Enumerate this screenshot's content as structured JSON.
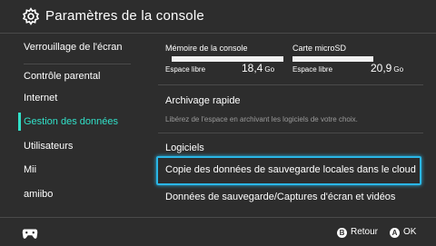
{
  "header": {
    "title": "Paramètres de la console",
    "icon": "gear-icon"
  },
  "sidebar": {
    "items": [
      {
        "label": "Verrouillage de l'écran",
        "selected": false
      },
      {
        "label": "Contrôle parental",
        "selected": false
      },
      {
        "label": "Internet",
        "selected": false
      },
      {
        "label": "Gestion des données",
        "selected": true
      },
      {
        "label": "Utilisateurs",
        "selected": false
      },
      {
        "label": "Mii",
        "selected": false
      },
      {
        "label": "amiibo",
        "selected": false
      }
    ]
  },
  "storage": {
    "console": {
      "title": "Mémoire de la console",
      "free_label": "Espace libre",
      "value": "18,4",
      "unit": "Go",
      "used_fraction": 0.05
    },
    "sd": {
      "title": "Carte microSD",
      "free_label": "Espace libre",
      "value": "20,9",
      "unit": "Go",
      "used_fraction": 0.6
    }
  },
  "main": {
    "archive": {
      "title": "Archivage rapide",
      "hint": "Libérez de l'espace en archivant les logiciels de votre choix."
    },
    "software": "Logiciels",
    "cloud_backup": "Copie des données de sauvegarde locales dans le cloud",
    "save_data": "Données de sauvegarde/Captures d'écran et vidéos"
  },
  "footer": {
    "back_button": "B",
    "back_label": "Retour",
    "ok_button": "A",
    "ok_label": "OK"
  },
  "colors": {
    "accent": "#31e0c8",
    "focus": "#2ab6e6",
    "background": "#2d2d2d"
  }
}
